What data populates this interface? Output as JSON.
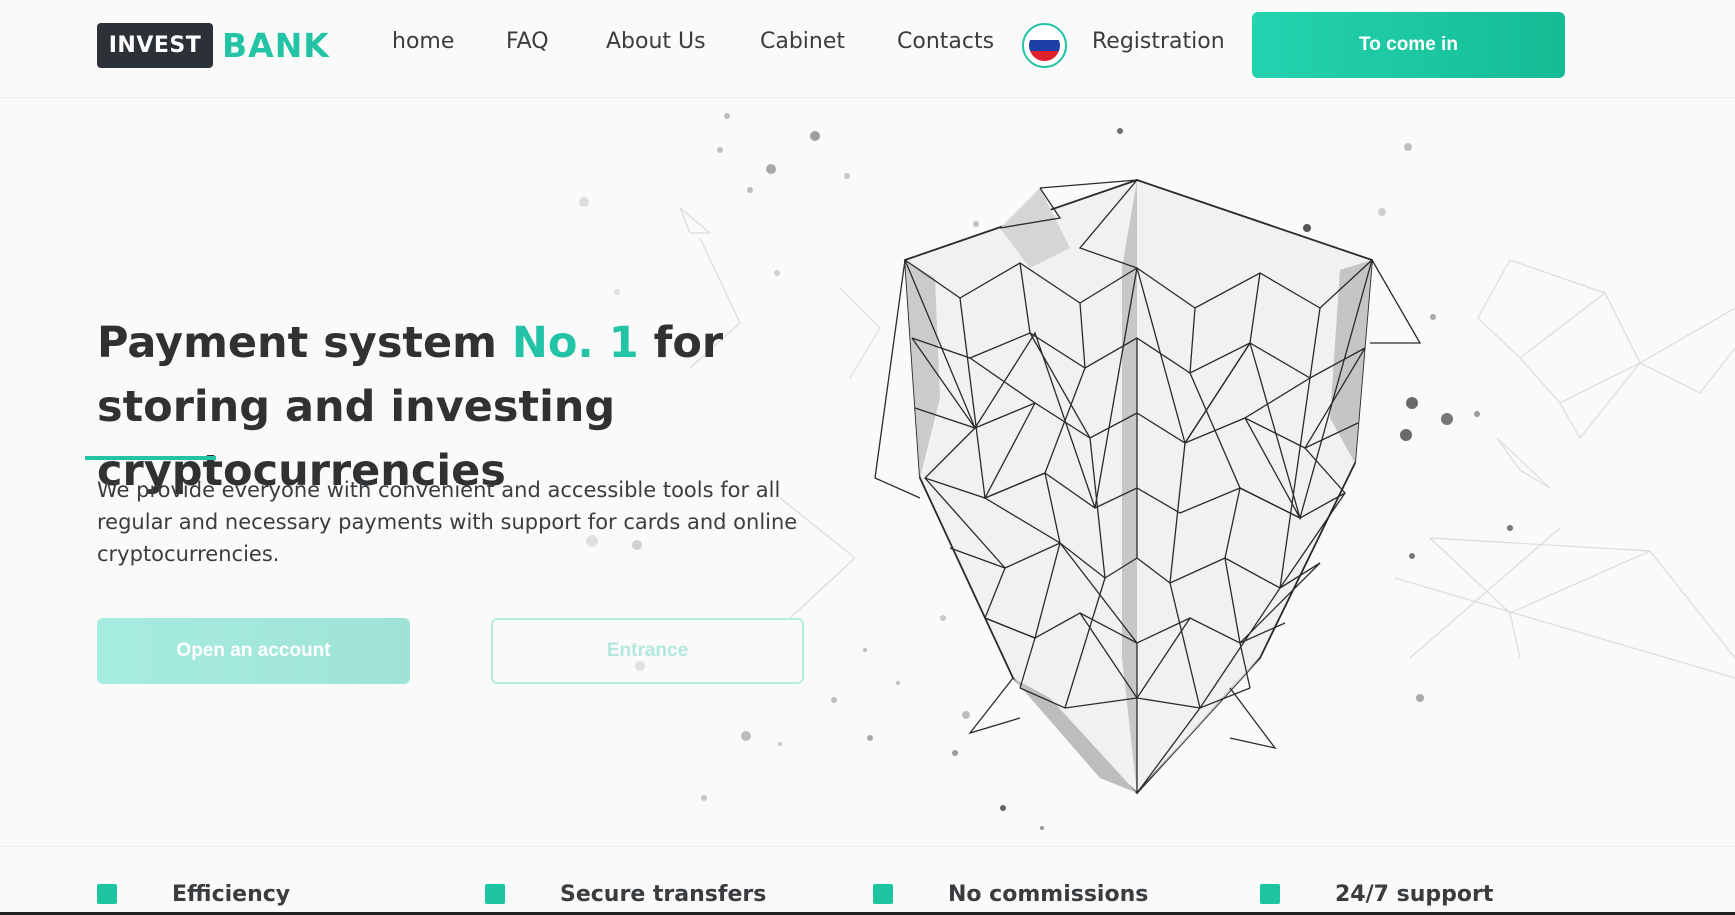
{
  "header": {
    "logo_box_text": "INVEST",
    "logo_accent_text": "BANK",
    "nav": [
      {
        "label": "home"
      },
      {
        "label": "FAQ"
      },
      {
        "label": "About Us"
      },
      {
        "label": "Cabinet"
      },
      {
        "label": "Contacts"
      },
      {
        "label": "Registration"
      }
    ],
    "language_flag": "russia-flag-icon",
    "login_label": "To come in"
  },
  "hero": {
    "title_before": "Payment system ",
    "title_accent": "No. 1",
    "title_after": " for storing and investing cryptocurrencies",
    "description": "We provide everyone with convenient and accessible tools for all regular and necessary payments with support for cards and online cryptocurrencies.",
    "open_account_label": "Open an account",
    "entrance_label": "Entrance",
    "illustration": "polygonal-shield-icon"
  },
  "features": [
    {
      "label": "Efficiency"
    },
    {
      "label": "Secure transfers"
    },
    {
      "label": "No commissions"
    },
    {
      "label": "24/7 support"
    }
  ],
  "colors": {
    "accent": "#23c4a5",
    "dark": "#2c3138",
    "background": "#fafafa"
  }
}
